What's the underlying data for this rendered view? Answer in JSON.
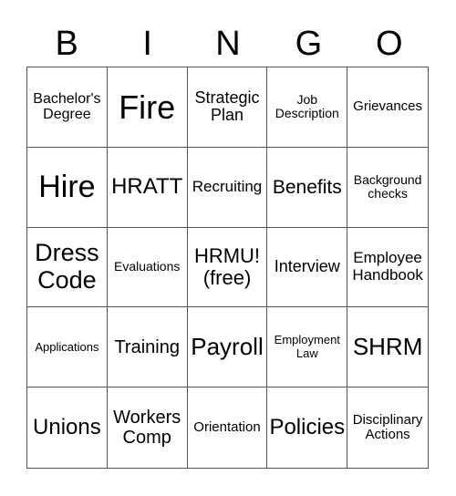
{
  "header": [
    "B",
    "I",
    "N",
    "G",
    "O"
  ],
  "cells": [
    "Bachelor's Degree",
    "Fire",
    "Strategic Plan",
    "Job Description",
    "Grievances",
    "Hire",
    "HRATT",
    "Recruiting",
    "Benefits",
    "Background checks",
    "Dress Code",
    "Evaluations",
    "HRMU! (free)",
    "Interview",
    "Employee Handbook",
    "Applications",
    "Training",
    "Payroll",
    "Employment Law",
    "SHRM",
    "Unions",
    "Workers Comp",
    "Orientation",
    "Policies",
    "Disciplinary Actions"
  ]
}
